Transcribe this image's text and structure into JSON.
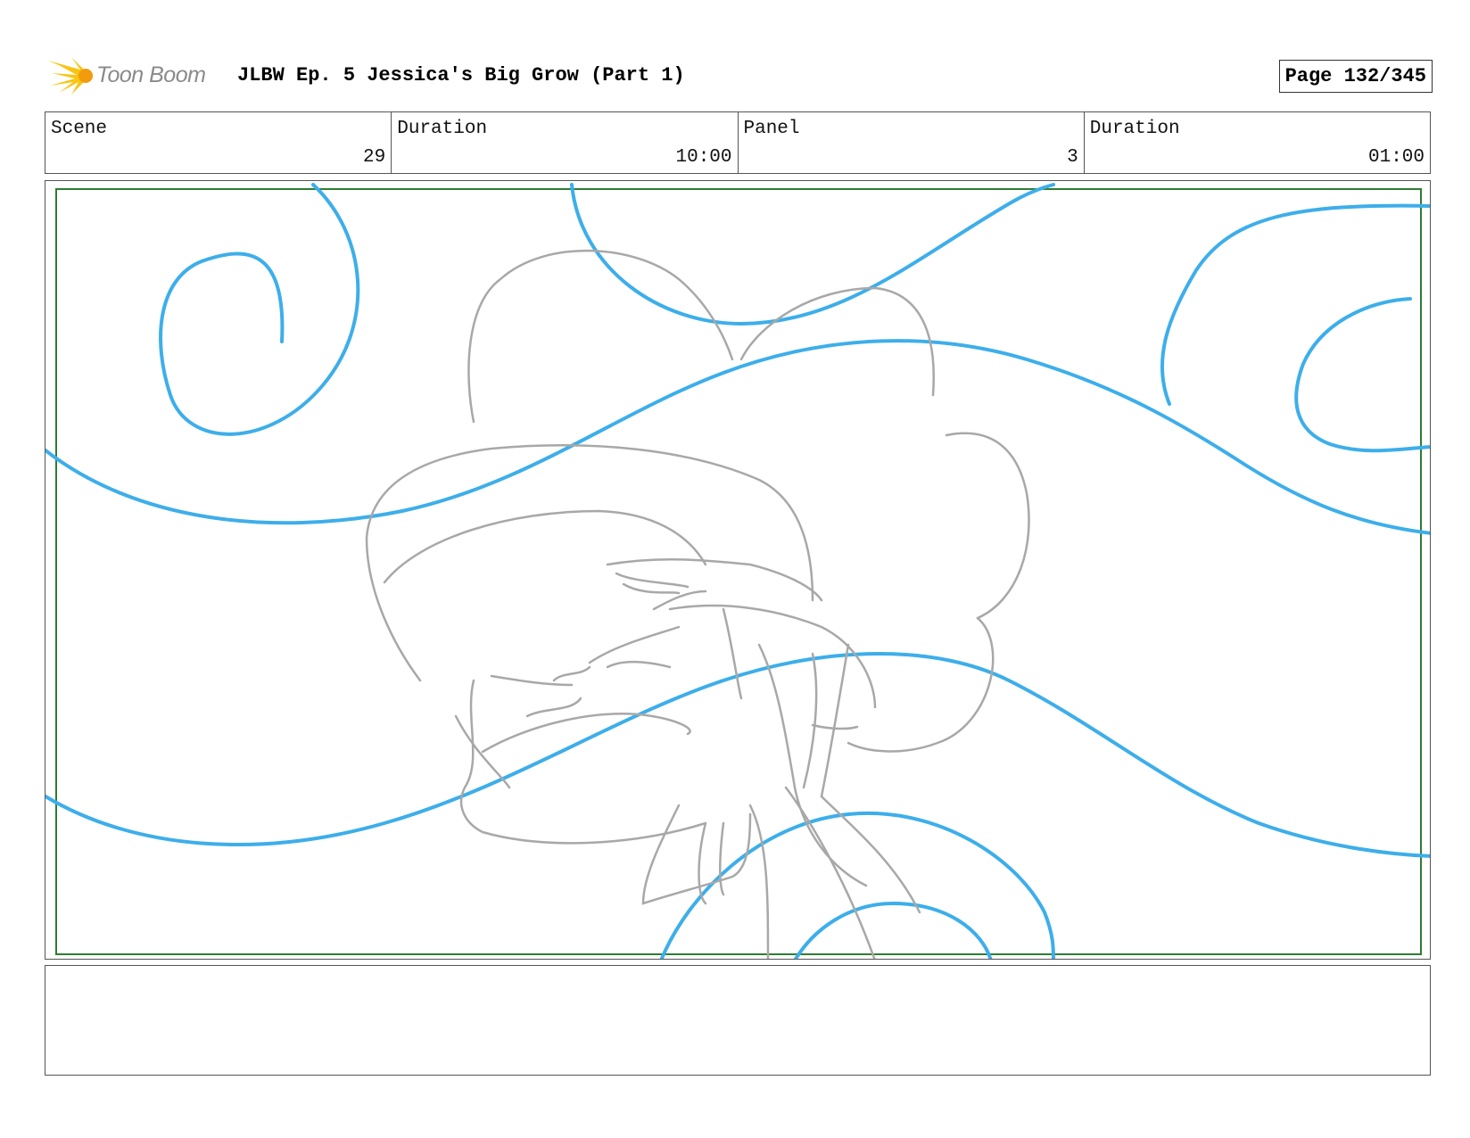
{
  "header": {
    "logo_text": "Toon Boom",
    "title": "JLBW Ep. 5 Jessica's Big Grow (Part 1)",
    "page_label": "Page 132/345"
  },
  "info": {
    "scene_label": "Scene",
    "scene_value": "29",
    "scene_duration_label": "Duration",
    "scene_duration_value": "10:00",
    "panel_label": "Panel",
    "panel_value": "3",
    "panel_duration_label": "Duration",
    "panel_duration_value": "01:00"
  },
  "notes": {
    "text": ""
  },
  "colors": {
    "swirl": "#3daeea",
    "sketch": "#a8a8a8",
    "safe_frame": "#2e7d32",
    "logo_star": "#f7c514"
  }
}
